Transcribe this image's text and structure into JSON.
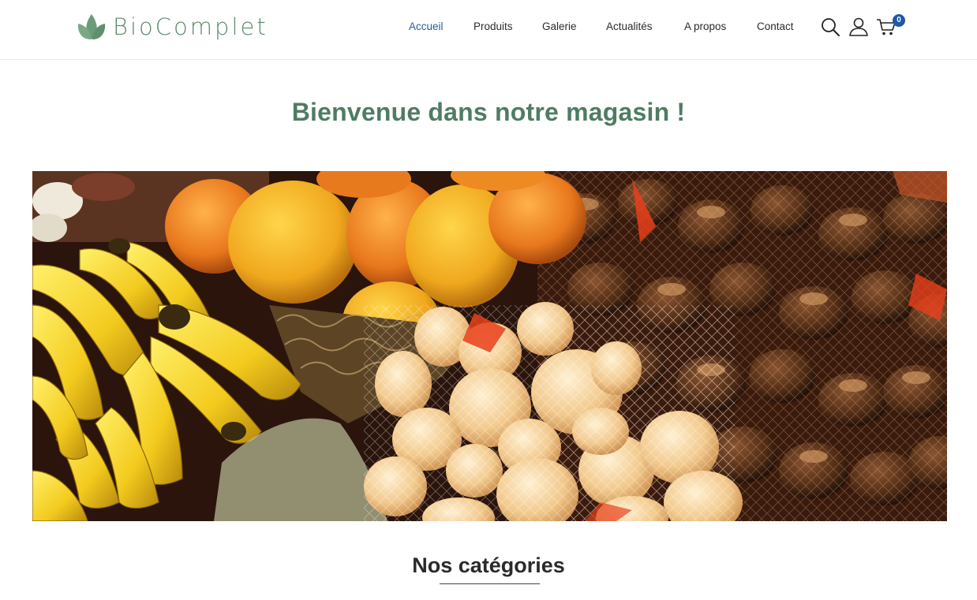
{
  "brand": {
    "name": "BioComplet",
    "color": "#5c8a6a"
  },
  "nav": {
    "items": [
      {
        "label": "Accueil",
        "active": true
      },
      {
        "label": "Produits",
        "active": false
      },
      {
        "label": "Galerie",
        "active": false
      },
      {
        "label": "Actualités",
        "active": false
      },
      {
        "label": "A propos",
        "active": false
      },
      {
        "label": "Contact",
        "active": false
      }
    ],
    "active_color": "#2a5c9a"
  },
  "header_icons": {
    "search": "search-icon",
    "account": "user-icon",
    "cart": "cart-icon"
  },
  "cart": {
    "count": "0",
    "badge_color": "#1f58a8"
  },
  "hero": {
    "title": "Bienvenue dans notre magasin !",
    "title_color": "#4f7c63",
    "image": "Étal de marché : bananes, oranges, oignons et châtaignes en filets"
  },
  "categories": {
    "title": "Nos catégories"
  }
}
